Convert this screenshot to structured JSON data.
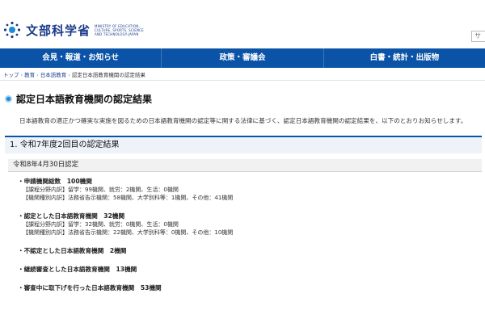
{
  "header": {
    "logo_name": "文部科学省",
    "logo_en": "MINISTRY OF EDUCATION, CULTURE, SPORTS, SCIENCE AND TECHNOLOGY-JAPAN",
    "search_partial": "サ"
  },
  "nav": {
    "items": [
      {
        "label": "会見・報道・お知らせ"
      },
      {
        "label": "政策・審議会"
      },
      {
        "label": "白書・統計・出版物"
      }
    ]
  },
  "breadcrumb": {
    "items": [
      {
        "label": "トップ"
      },
      {
        "label": "教育"
      },
      {
        "label": "日本語教育"
      }
    ],
    "current": "認定日本語教育機関の認定結果"
  },
  "page": {
    "title": "認定日本語教育機関の認定結果",
    "intro": "日本語教育の適正かつ確実な実施を図るための日本語教育機関の認定等に関する法律に基づく、認定日本語教育機関の認定結果を、以下のとおりお知らせします。",
    "section_heading": "1. 令和7年度2回目の認定結果",
    "date_heading": "令和8年4月30日認定"
  },
  "results": [
    {
      "title": "・申請機関総数　100機関",
      "details": [
        "【課程分野内訳】留学：99機関、就労：2機関、生活：0機関",
        "【機関種別内訳】法務省告示機関：58機関、大学別科等：1機関、その他：41機関"
      ]
    },
    {
      "title": "・認定とした日本語教育機関　32機関",
      "details": [
        "【課程分野内訳】留学：32機関、就労：0機関、生活：0機関",
        "【機関種別内訳】法務省告示機関：22機関、大学別科等：0機関、その他：10機関"
      ]
    },
    {
      "title": "・不認定とした日本語教育機関　2機関",
      "details": []
    },
    {
      "title": "・継続審査とした日本語教育機関　13機関",
      "details": []
    },
    {
      "title": "・審査中に取下げを行った日本語教育機関　53機関",
      "details": []
    }
  ],
  "colors": {
    "nav_bg": "#0b53a6",
    "logo": "#1b3b8a",
    "title_bullet": "#1e8ad6"
  }
}
